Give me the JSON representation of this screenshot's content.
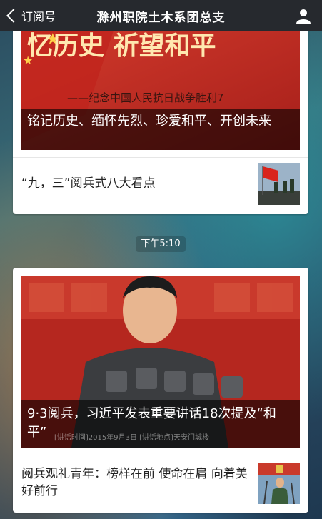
{
  "header": {
    "back_label": "订阅号",
    "title": "滁州职院土木系团总支"
  },
  "messages": [
    {
      "hero_banner_text": "忆历史  祈望和平",
      "hero_banner_subtitle": "——纪念中国人民抗日战争胜利7",
      "hero_caption": "铭记历史、缅怀先烈、珍爱和平、开创未来",
      "items": [
        {
          "title": "“九，三”阅兵式八大看点"
        }
      ]
    },
    {
      "timestamp": "下午5:10",
      "hero_caption": "9·3阅兵，习近平发表重要讲话18次提及“和平”",
      "hero_overlay_text": "[讲话时间]2015年9月3日    [讲话地点]天安门城楼",
      "items": [
        {
          "title": "阅兵观礼青年：榜样在前 使命在肩 向着美好前行"
        }
      ]
    }
  ]
}
